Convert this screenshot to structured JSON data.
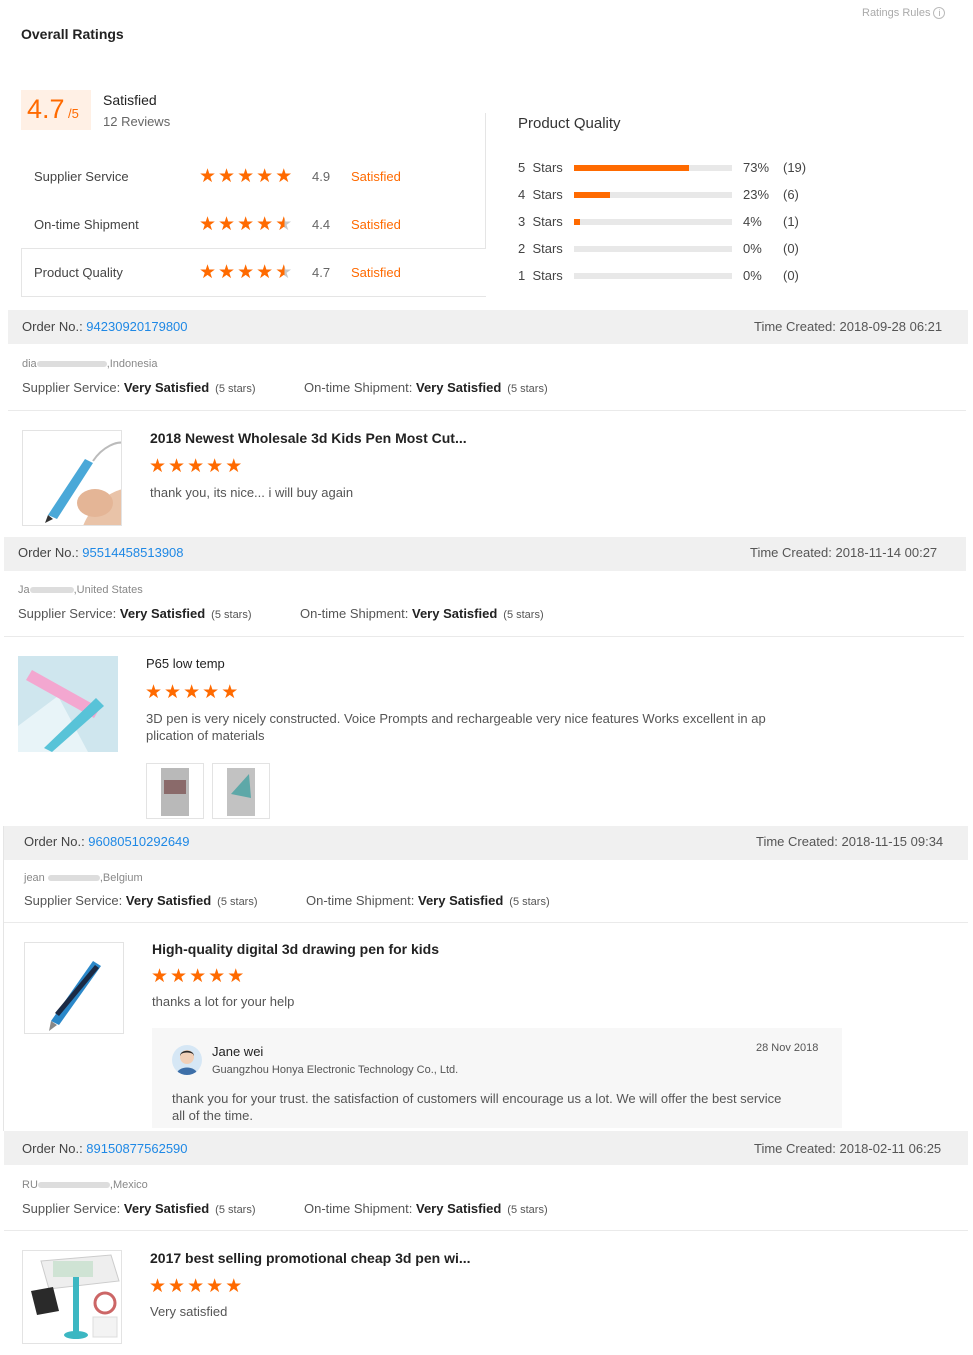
{
  "header": {
    "title": "Overall Ratings",
    "rules_link": "Ratings Rules",
    "rules_icon": "info-icon"
  },
  "overall": {
    "score": "4.7",
    "out_of": "/5",
    "label": "Satisfied",
    "reviews": "12 Reviews"
  },
  "summary": [
    {
      "label": "Supplier Service",
      "score": "4.9",
      "status": "Satisfied",
      "stars": 4.9
    },
    {
      "label": "On-time Shipment",
      "score": "4.4",
      "status": "Satisfied",
      "stars": 4.4
    },
    {
      "label": "Product Quality",
      "score": "4.7",
      "status": "Satisfied",
      "stars": 4.7
    }
  ],
  "distribution": {
    "title": "Product Quality",
    "rows": [
      {
        "label": "5  Stars",
        "pct": "73%",
        "count": "(19)",
        "fill": 0.73
      },
      {
        "label": "4  Stars",
        "pct": "23%",
        "count": "(6)",
        "fill": 0.23
      },
      {
        "label": "3  Stars",
        "pct": "4%",
        "count": "(1)",
        "fill": 0.04
      },
      {
        "label": "2  Stars",
        "pct": "0%",
        "count": "(0)",
        "fill": 0
      },
      {
        "label": "1  Stars",
        "pct": "0%",
        "count": "(0)",
        "fill": 0
      }
    ]
  },
  "orders": [
    {
      "order_label": "Order No.: ",
      "order_no": "94230920179800",
      "time": "Time Created: 2018-09-28 06:21",
      "buyer_prefix": "dia",
      "buyer_country": ",Indonesia",
      "supplier_label": "Supplier Service: ",
      "supplier_value": "Very Satisfied",
      "supplier_stars": "(5 stars)",
      "shipment_label": "On-time Shipment: ",
      "shipment_value": "Very Satisfied",
      "shipment_stars": "(5 stars)",
      "product_title": "2018 Newest Wholesale 3d Kids Pen Most Cut...",
      "rating": 5,
      "review": "thank you,  its nice... i will buy again"
    },
    {
      "order_label": "Order No.: ",
      "order_no": "95514458513908",
      "time": "Time Created: 2018-11-14 00:27",
      "buyer_prefix": "Ja",
      "buyer_country": ",United States",
      "supplier_label": "Supplier Service: ",
      "supplier_value": "Very Satisfied",
      "supplier_stars": "(5 stars)",
      "shipment_label": "On-time Shipment: ",
      "shipment_value": "Very Satisfied",
      "shipment_stars": "(5 stars)",
      "product_title": "P65 low temp",
      "rating": 5,
      "review_line1": "3D pen is very nicely constructed. Voice Prompts and rechargeable very nice features Works excellent in ap",
      "review_line2": "plication of materials"
    },
    {
      "order_label": "Order No.: ",
      "order_no": "96080510292649",
      "time": "Time Created: 2018-11-15 09:34",
      "buyer_prefix": "jean",
      "buyer_country": ",Belgium",
      "supplier_label": "Supplier Service: ",
      "supplier_value": "Very Satisfied",
      "supplier_stars": "(5 stars)",
      "shipment_label": "On-time Shipment: ",
      "shipment_value": "Very Satisfied",
      "shipment_stars": "(5 stars)",
      "product_title": "High-quality digital 3d drawing pen for kids",
      "rating": 5,
      "review": "thanks a lot for your help",
      "reply": {
        "name": "Jane wei",
        "company": "Guangzhou Honya Electronic Technology Co., Ltd.",
        "date": "28 Nov 2018",
        "text_line1": "thank you for your trust. the satisfaction of customers will encourage us a lot. We will offer the best service",
        "text_line2": "all of the time."
      }
    },
    {
      "order_label": "Order No.: ",
      "order_no": "89150877562590",
      "time": "Time Created: 2018-02-11 06:25",
      "buyer_prefix": "RU",
      "buyer_country": ",Mexico",
      "supplier_label": "Supplier Service: ",
      "supplier_value": "Very Satisfied",
      "supplier_stars": "(5 stars)",
      "shipment_label": "On-time Shipment: ",
      "shipment_value": "Very Satisfied",
      "shipment_stars": "(5 stars)",
      "product_title": "2017 best selling promotional cheap 3d pen wi...",
      "rating": 5,
      "review": "Very satisfied"
    }
  ],
  "colors": {
    "accent": "#ff6a00",
    "link": "#1e88e5",
    "order_bar": "#f0f0f0"
  }
}
